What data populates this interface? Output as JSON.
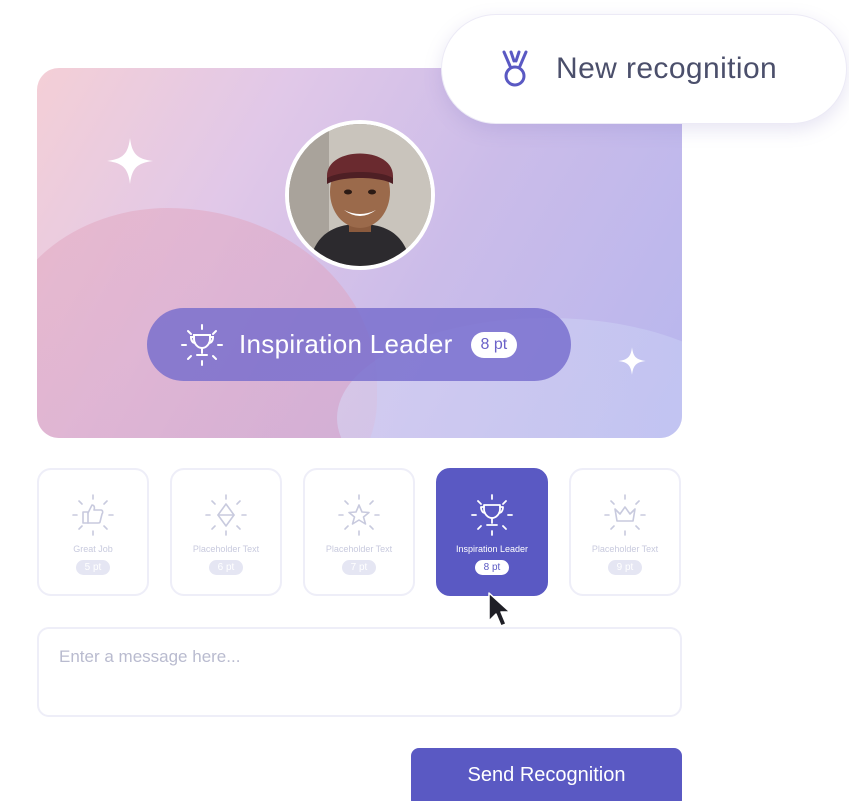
{
  "header_chip": {
    "label": "New recognition",
    "icon": "medal-icon"
  },
  "recipient": {
    "avatar_icon": "person-avatar"
  },
  "selected_award": {
    "title": "Inspiration Leader",
    "points": "8 pt",
    "icon": "trophy-icon"
  },
  "awards": [
    {
      "label": "Great Job",
      "points": "5 pt",
      "icon": "thumbs-up-icon",
      "selected": false
    },
    {
      "label": "Placeholder Text",
      "points": "6 pt",
      "icon": "diamond-icon",
      "selected": false
    },
    {
      "label": "Placeholder Text",
      "points": "7 pt",
      "icon": "star-icon",
      "selected": false
    },
    {
      "label": "Inspiration Leader",
      "points": "8 pt",
      "icon": "trophy-icon",
      "selected": true
    },
    {
      "label": "Placeholder Text",
      "points": "9 pt",
      "icon": "crown-icon",
      "selected": false
    }
  ],
  "message": {
    "placeholder": "Enter a message here...",
    "value": ""
  },
  "send_button": {
    "label": "Send Recognition"
  },
  "colors": {
    "accent": "#5a59c3",
    "pill": "#766ccd",
    "muted": "#c8cade"
  }
}
